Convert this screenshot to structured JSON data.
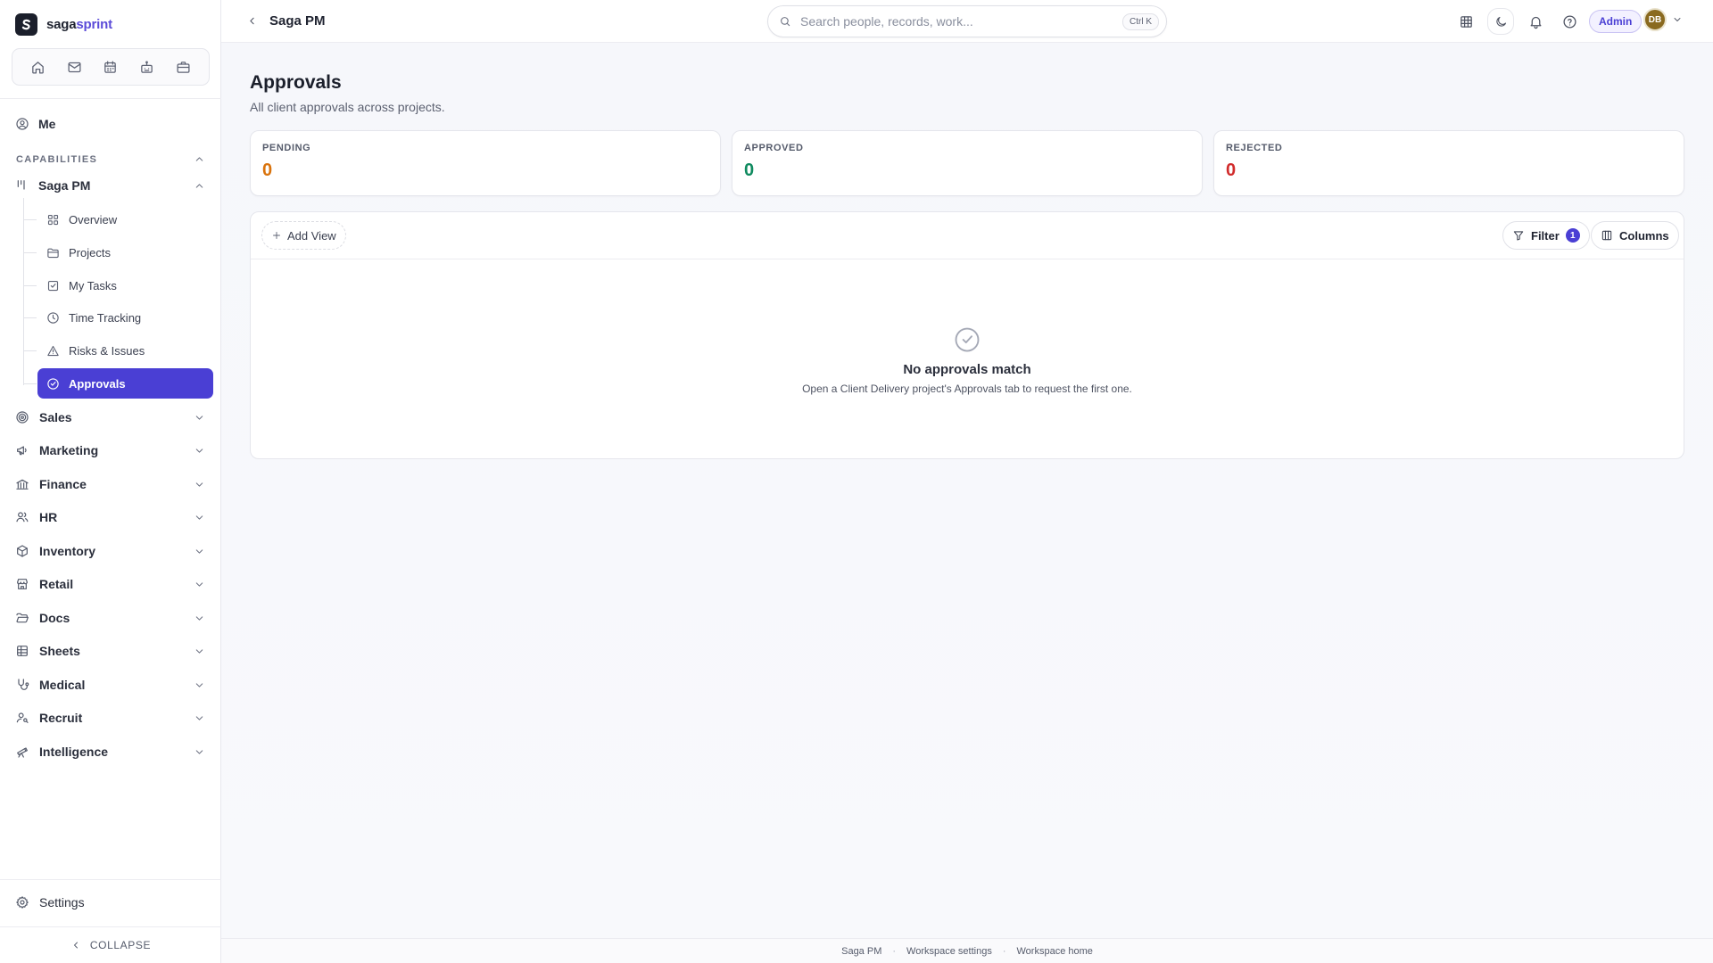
{
  "brand": {
    "part1": "saga",
    "part2": "sprint"
  },
  "quickbar": [
    "home-icon",
    "mail-icon",
    "calendar-icon",
    "bot-icon",
    "briefcase-icon"
  ],
  "sidebar": {
    "me_label": "Me",
    "capabilities_label": "CAPABILITIES",
    "saga_pm_label": "Saga PM",
    "pm_items": [
      {
        "label": "Overview",
        "icon": "overview-grid-icon"
      },
      {
        "label": "Projects",
        "icon": "folder-icon"
      },
      {
        "label": "My Tasks",
        "icon": "checkbox-icon"
      },
      {
        "label": "Time Tracking",
        "icon": "clock-icon"
      },
      {
        "label": "Risks & Issues",
        "icon": "warning-icon"
      },
      {
        "label": "Approvals",
        "icon": "check-circle-icon",
        "active": true
      }
    ],
    "groups": [
      {
        "label": "Sales",
        "icon": "target-icon"
      },
      {
        "label": "Marketing",
        "icon": "megaphone-icon"
      },
      {
        "label": "Finance",
        "icon": "bank-icon"
      },
      {
        "label": "HR",
        "icon": "people-icon"
      },
      {
        "label": "Inventory",
        "icon": "box-icon"
      },
      {
        "label": "Retail",
        "icon": "store-icon"
      },
      {
        "label": "Docs",
        "icon": "folder-open-icon"
      },
      {
        "label": "Sheets",
        "icon": "sheet-icon"
      },
      {
        "label": "Medical",
        "icon": "stethoscope-icon"
      },
      {
        "label": "Recruit",
        "icon": "user-search-icon"
      },
      {
        "label": "Intelligence",
        "icon": "telescope-icon"
      }
    ],
    "settings_label": "Settings",
    "collapse_label": "COLLAPSE"
  },
  "topbar": {
    "breadcrumb": "Saga PM",
    "search_placeholder": "Search people, records, work...",
    "search_shortcut": "Ctrl K",
    "admin_label": "Admin",
    "avatar_initials": "DB"
  },
  "page": {
    "title": "Approvals",
    "subtitle": "All client approvals across projects."
  },
  "stats": [
    {
      "label": "PENDING",
      "value": "0",
      "color": "#d9730d"
    },
    {
      "label": "APPROVED",
      "value": "0",
      "color": "#0f8a5f"
    },
    {
      "label": "REJECTED",
      "value": "0",
      "color": "#d12b2b"
    }
  ],
  "toolbar": {
    "add_view_label": "Add View",
    "filter_label": "Filter",
    "filter_count": "1",
    "columns_label": "Columns"
  },
  "empty_state": {
    "title": "No approvals match",
    "message": "Open a Client Delivery project's Approvals tab to request the first one."
  },
  "footer": {
    "links": [
      "Saga PM",
      "Workspace settings",
      "Workspace home"
    ]
  },
  "colors": {
    "accent": "#4a3fd4",
    "brand_secondary": "#5b4bd8"
  }
}
